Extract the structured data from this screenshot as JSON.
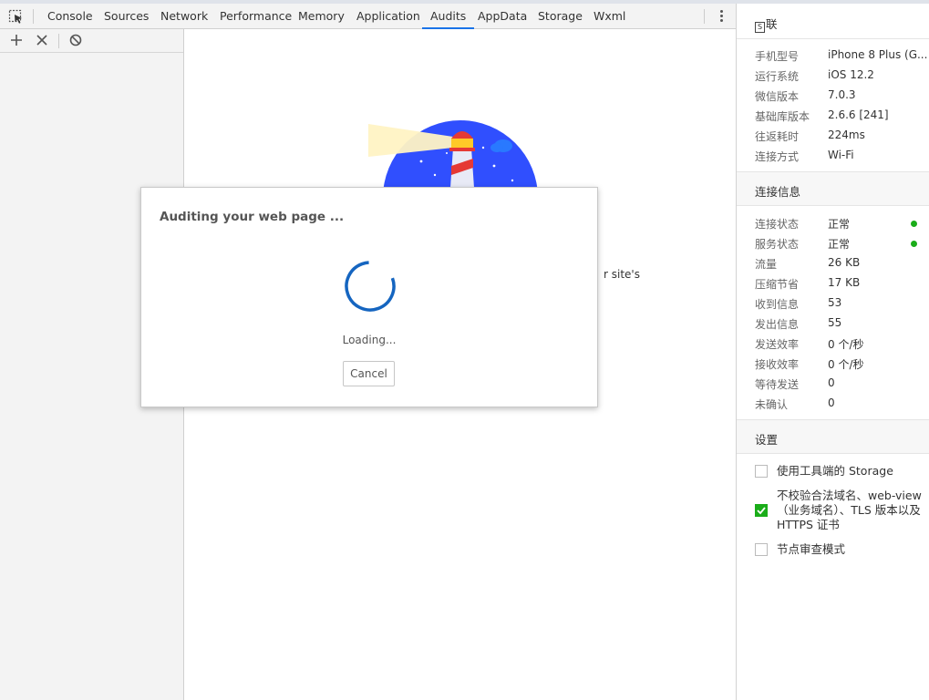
{
  "tabs": [
    {
      "label": "Console",
      "active": false
    },
    {
      "label": "Sources",
      "active": false
    },
    {
      "label": "Network",
      "active": false
    },
    {
      "label": "Performance",
      "active": false
    },
    {
      "label": "Memory",
      "active": false
    },
    {
      "label": "Application",
      "active": false
    },
    {
      "label": "Audits",
      "active": true
    },
    {
      "label": "AppData",
      "active": false
    },
    {
      "label": "Storage",
      "active": false
    },
    {
      "label": "Wxml",
      "active": false
    }
  ],
  "toolbar": {
    "add_icon": "plus-icon",
    "clear_icon": "close-icon",
    "block_icon": "block-icon"
  },
  "main": {
    "bg_text_fragment": "r site's"
  },
  "modal": {
    "title": "Auditing your web page ...",
    "loading_text": "Loading...",
    "cancel_label": "Cancel"
  },
  "info_panel": {
    "device_title": "联",
    "device_rows": [
      {
        "key": "手机型号",
        "value": "iPhone 8 Plus (G..."
      },
      {
        "key": "运行系统",
        "value": "iOS 12.2"
      },
      {
        "key": "微信版本",
        "value": "7.0.3"
      },
      {
        "key": "基础库版本",
        "value": "2.6.6 [241]"
      },
      {
        "key": "往返耗时",
        "value": "224ms"
      },
      {
        "key": "连接方式",
        "value": "Wi-Fi"
      }
    ],
    "conn_title": "连接信息",
    "conn_rows": [
      {
        "key": "连接状态",
        "value": "正常"
      },
      {
        "key": "服务状态",
        "value": "正常"
      },
      {
        "key": "流量",
        "value": "26 KB"
      },
      {
        "key": "压缩节省",
        "value": "17 KB"
      },
      {
        "key": "收到信息",
        "value": "53"
      },
      {
        "key": "发出信息",
        "value": "55"
      },
      {
        "key": "发送效率",
        "value": "0 个/秒"
      },
      {
        "key": "接收效率",
        "value": "0 个/秒"
      },
      {
        "key": "等待发送",
        "value": "0"
      },
      {
        "key": "未确认",
        "value": "0"
      }
    ],
    "settings_title": "设置",
    "settings": [
      {
        "label": "使用工具端的 Storage",
        "checked": false
      },
      {
        "label": "不校验合法域名、web-view（业务域名）、TLS 版本以及 HTTPS 证书",
        "checked": true
      },
      {
        "label": "节点审查模式",
        "checked": false
      }
    ]
  },
  "colors": {
    "accent": "#1a73e8",
    "spinner": "#1565c0",
    "status_ok": "#1aad19"
  }
}
